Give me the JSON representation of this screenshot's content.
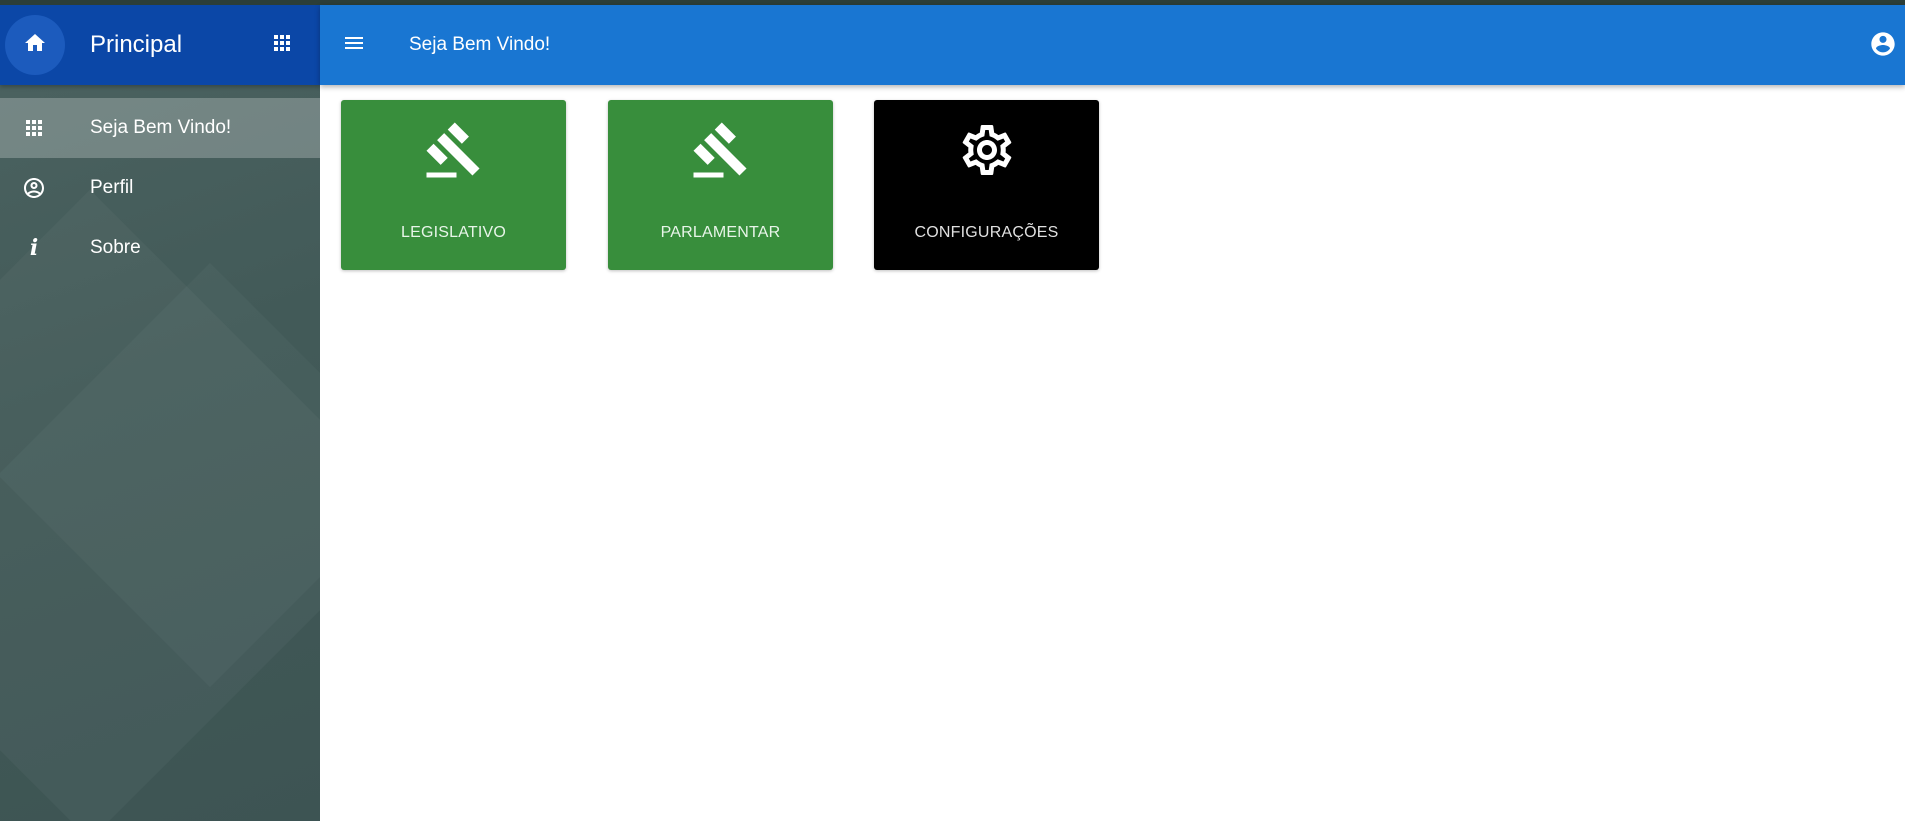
{
  "sidebar": {
    "title": "Principal",
    "home_icon": "home-icon",
    "apps_icon": "apps-grid-icon",
    "items": [
      {
        "label": "Seja Bem Vindo!",
        "icon": "apps-grid-icon",
        "active": true
      },
      {
        "label": "Perfil",
        "icon": "account-circle-icon",
        "active": false
      },
      {
        "label": "Sobre",
        "icon": "info-icon",
        "active": false
      }
    ]
  },
  "topbar": {
    "title": "Seja Bem Vindo!",
    "menu_icon": "menu-icon",
    "account_icon": "account-circle-icon"
  },
  "tiles": [
    {
      "label": "LEGISLATIVO",
      "icon": "gavel-icon",
      "color": "#388e3c",
      "text_color": "#e8f5e9"
    },
    {
      "label": "PARLAMENTAR",
      "icon": "gavel-icon",
      "color": "#388e3c",
      "text_color": "#e8f5e9"
    },
    {
      "label": "CONFIGURAÇÕES",
      "icon": "gear-icon",
      "color": "#000000",
      "text_color": "#e0e0e0"
    }
  ],
  "colors": {
    "sidebar_header": "#0b47a7",
    "topbar": "#1976d2",
    "sidebar_bg": "#455c5b"
  }
}
